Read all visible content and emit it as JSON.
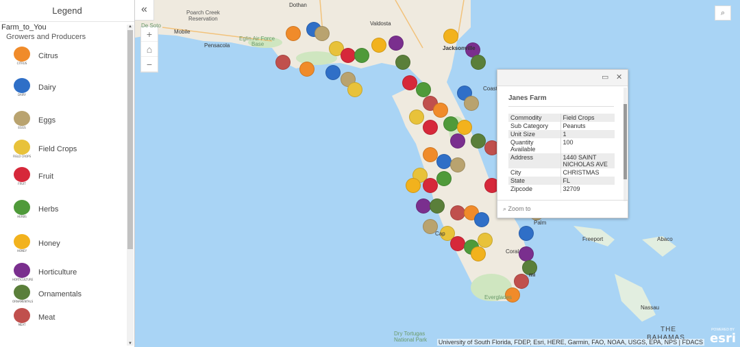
{
  "legend": {
    "title": "Legend",
    "layer": "Farm_to_You",
    "sublayer": "Growers and Producers",
    "items": [
      {
        "label": "Citrus",
        "tag": "CITRUS",
        "color": "#f08b2a",
        "icon": "citrus-icon"
      },
      {
        "label": "Dairy",
        "tag": "DAIRY",
        "color": "#2f6fc7",
        "icon": "dairy-icon"
      },
      {
        "label": "Eggs",
        "tag": "EGGS",
        "color": "#b9a36f",
        "icon": "eggs-icon"
      },
      {
        "label": "Field Crops",
        "tag": "FIELD CROPS",
        "color": "#e8c23a",
        "icon": "field-crops-icon"
      },
      {
        "label": "Fruit",
        "tag": "FRUIT",
        "color": "#d6283a",
        "icon": "fruit-icon"
      },
      {
        "label": "Herbs",
        "tag": "HERBS",
        "color": "#4f9a3a",
        "icon": "herbs-icon"
      },
      {
        "label": "Honey",
        "tag": "HONEY",
        "color": "#f2b21d",
        "icon": "honey-icon"
      },
      {
        "label": "Horticulture",
        "tag": "HORTICULTURE",
        "color": "#7a2f8e",
        "icon": "horticulture-icon"
      },
      {
        "label": "Ornamentals",
        "tag": "ORNAMENTALS",
        "color": "#5a7f3a",
        "icon": "ornamentals-icon"
      },
      {
        "label": "Meat",
        "tag": "MEAT",
        "color": "#c0504d",
        "icon": "meat-icon"
      }
    ]
  },
  "map": {
    "labels": {
      "dothan": "Dothan",
      "poarch": "Poarch Creek",
      "reservation": "Reservation",
      "mobile": "Mobile",
      "pensacola": "Pensacola",
      "eglin": "Eglin Air Force",
      "base": "Base",
      "desoto": "De Soto",
      "valdosta": "Valdosta",
      "jacksonville": "Jacksonville",
      "coast": "Coast",
      "palm": "Palm",
      "cap": "Cap",
      "coral": "Coral",
      "mi": "mi",
      "freeport": "Freeport",
      "abaco": "Abaco",
      "nassau": "Nassau",
      "bahamas1": "THE",
      "bahamas2": "BAHAMAS",
      "everglades": "Everglades",
      "tortugas1": "Dry Tortugas",
      "tortugas2": "National Park"
    },
    "attribution": "University of South Florida, FDEP, Esri, HERE, Garmin, FAO, NOAA, USGS, EPA, NPS | FDACS",
    "esri": "esri",
    "powered": "POWERED BY"
  },
  "popup": {
    "title": "Janes Farm",
    "zoom_to": "Zoom to",
    "rows": [
      {
        "key": "Commodity",
        "value": "Field Crops"
      },
      {
        "key": "Sub Category",
        "value": "Peanuts"
      },
      {
        "key": "Unit Size",
        "value": "1"
      },
      {
        "key": "Quantity Available",
        "value": "100"
      },
      {
        "key": "Address",
        "value": "1440 SAINT NICHOLAS AVE"
      },
      {
        "key": "City",
        "value": "CHRISTMAS"
      },
      {
        "key": "State",
        "value": "FL"
      },
      {
        "key": "Zipcode",
        "value": "32709"
      }
    ]
  }
}
